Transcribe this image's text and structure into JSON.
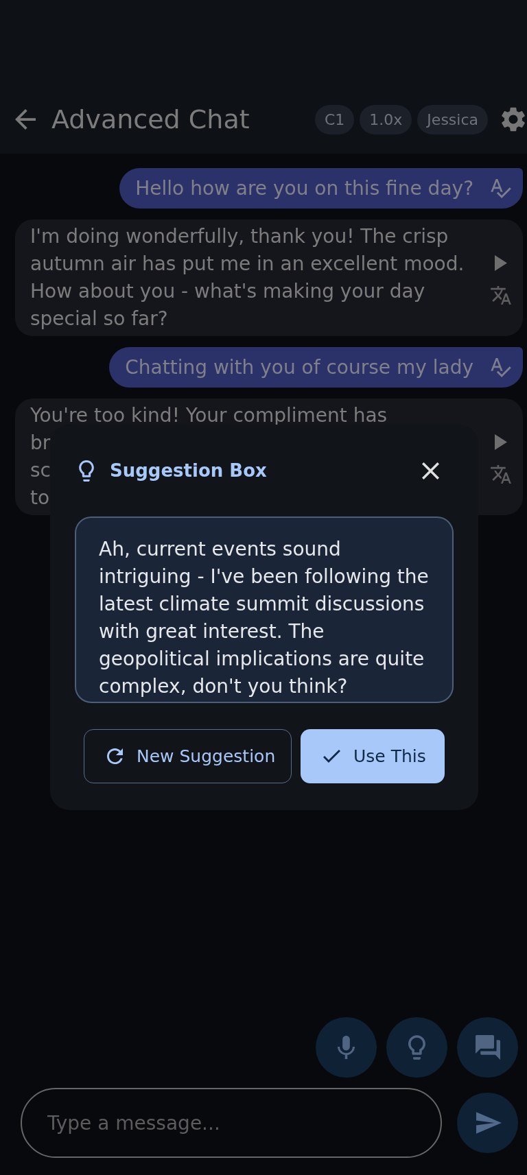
{
  "app_bar": {
    "title": "Advanced Chat",
    "chips": [
      "C1",
      "1.0x",
      "Jessica"
    ]
  },
  "messages": [
    {
      "kind": "sent",
      "text": "Hello how are you on this fine day?"
    },
    {
      "kind": "received",
      "text": "I'm doing wonderfully, thank you! The crisp autumn air has put me in an excellent mood. How about you - what's making your day special so far?"
    },
    {
      "kind": "sent",
      "text": "Chatting with you of course my lady"
    },
    {
      "kind": "received",
      "visible_lines": [
        "You're too kind! Your compliment has",
        "br",
        "sc",
        "to"
      ]
    }
  ],
  "suggestion_dialog": {
    "title": "Suggestion Box",
    "suggestion": "Ah, current events sound intriguing - I've been following the latest climate summit discussions with great interest. The geopolitical implications are quite complex, don't you think?",
    "buttons": [
      {
        "kind": "outlined",
        "label": "New Suggestion"
      },
      {
        "kind": "filled",
        "label": "Use This"
      }
    ]
  },
  "composer": {
    "placeholder": "Type a message..."
  }
}
